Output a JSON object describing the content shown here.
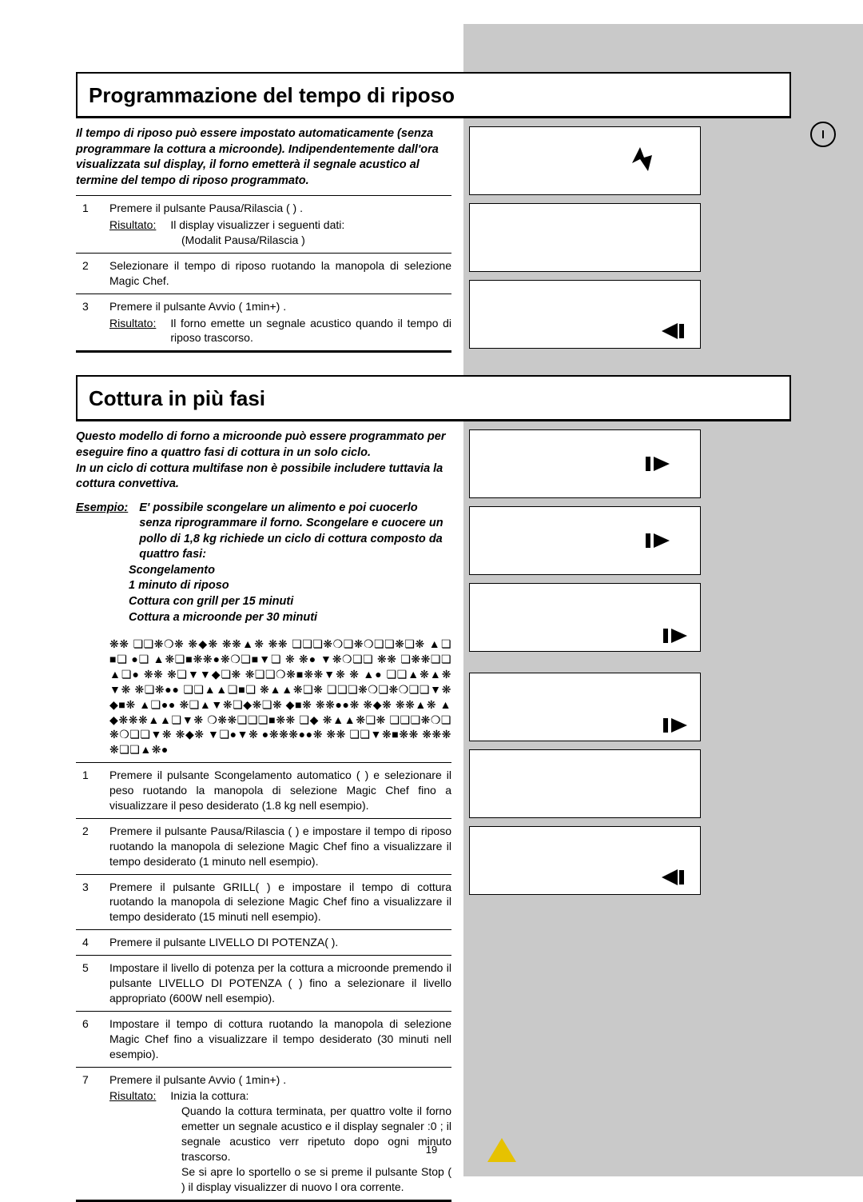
{
  "section1": {
    "title": "Programmazione del tempo di riposo",
    "intro": "Il tempo di riposo può essere impostato automaticamente (senza programmare la cottura a microonde). Indipendentemente dall'ora visualizzata sul display, il forno emetterà il segnale acustico al termine del tempo di riposo programmato.",
    "steps": [
      {
        "n": "1",
        "text": "Premere il pulsante Pausa/Rilascia (        ) .",
        "sub_label": "Risultato:",
        "sub_text": "Il display visualizzer  i seguenti dati:",
        "sub_text2": "(Modalit  Pausa/Rilascia )"
      },
      {
        "n": "2",
        "text": "Selezionare il tempo di riposo ruotando la manopola di selezione Magic Chef."
      },
      {
        "n": "3",
        "text": "Premere il pulsante Avvio (       1min+) .",
        "sub_label": "Risultato:",
        "sub_text": "Il forno emette un segnale acustico quando il tempo di riposo trascorso."
      }
    ]
  },
  "section2": {
    "title": "Cottura in più fasi",
    "intro": "Questo modello di forno a microonde può essere programmato per eseguire fino a quattro fasi di cottura in un solo ciclo.\nIn un ciclo di cottura multifase non è possibile includere tuttavia la cottura convettiva.",
    "example_label": "Esempio:",
    "example_text": "E' possibile scongelare un alimento e poi cuocerlo senza riprogrammare il forno. Scongelare e cuocere un pollo di 1,8 kg richiede un ciclo di cottura composto da quattro fasi:",
    "example_items": [
      "Scongelamento",
      "1 minuto di riposo",
      "Cottura con grill per 15 minuti",
      "Cottura a microonde per 30 minuti"
    ],
    "corrupt_note": "❋❋ ❏❏❋❍❋ ❋◆❋ ❋❋▲❋ ❋❋ ❏❏❏❋❍❏❋❍❏❏❋❏❋ ▲❏■❏ ●❏ ▲❋❏■❋❋●❋❍❏■▼❏ ❋ ❋● ▼❋❍❏❏ ❋❋ ❏❋❋❏❏▲❏● ❋❋ ❋❏▼▼◆❏❋ ❋❏❏❍❋■❋❋▼❋ ❋ ▲● ❏❏▲❋▲❋▼❋ ❋❏❋●● ❏❏▲▲❏■❏ ❋▲▲❋❏❋ ❏❏❏❋❍❏❋❍❏❏▼❋ ◆■❋ ▲❏●● ❋❏▲▼❋❏◆❋❏❋ ◆■❋ ❋❋●●❋ ❋◆❋ ❋❋▲❋ ▲◆❋❋❋▲▲❏▼❋ ❍❋❋❏❏❏■❋❋ ❏◆ ❋▲▲❋❏❋ ❏❏❏❋❍❏❋❍❏❏▼❋ ❋◆❋ ▼❏●▼❋ ●❋❋❋●●❋ ❋❋ ❏❏▼❋■❋❋ ❋❋❋❋❏❏▲❋●",
    "steps": [
      {
        "n": "1",
        "text": "Premere il pulsante Scongelamento automatico (        ) e selezionare il peso ruotando la manopola di selezione Magic Chef fino a visualizzare il peso desiderato (1.8 kg nell esempio)."
      },
      {
        "n": "2",
        "text": "Premere il pulsante Pausa/Rilascia (        ) e impostare il tempo di riposo ruotando la manopola di selezione Magic Chef fino a visualizzare il tempo desiderato (1 minuto nell esempio)."
      },
      {
        "n": "3",
        "text": "Premere il pulsante GRILL(        ) e impostare il tempo di cottura ruotando la manopola di selezione Magic Chef fino a visualizzare il tempo desiderato (15 minuti nell esempio)."
      },
      {
        "n": "4",
        "text": "Premere il pulsante LIVELLO DI POTENZA(        )."
      },
      {
        "n": "5",
        "text": "Impostare il livello di potenza per la cottura a microonde premendo il pulsante LIVELLO DI POTENZA (        ) fino a selezionare il livello appropriato (600W nell esempio)."
      },
      {
        "n": "6",
        "text": "Impostare il tempo di cottura ruotando la manopola di selezione Magic Chef fino a visualizzare il tempo desiderato (30 minuti nell esempio)."
      },
      {
        "n": "7",
        "text": "Premere il pulsante Avvio (       1min+) .",
        "sub_label": "Risultato:",
        "sub_text": "Inizia la cottura:",
        "sub_text2": "Quando la cottura   terminata, per quattro volte il forno emetter  un segnale acustico e il display segnaler   :0 ; il segnale acustico verr  ripetuto dopo ogni minuto trascorso.\nSe si apre lo sportello o se si preme il pulsante Stop (        ) il display visualizzer  di nuovo l ora corrente."
      }
    ]
  },
  "page_number": "19"
}
